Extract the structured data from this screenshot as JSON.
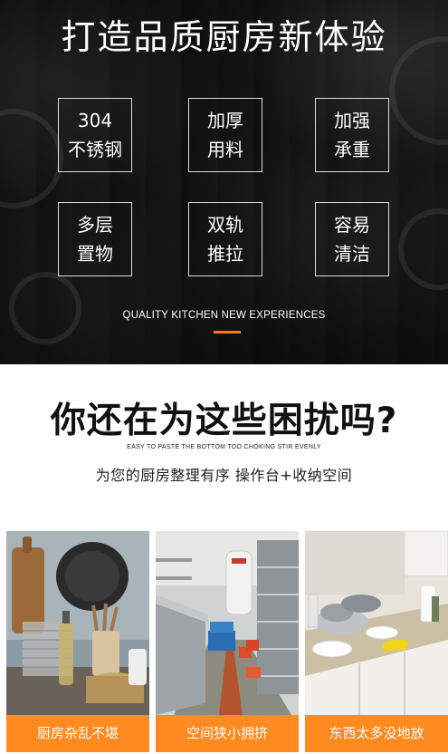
{
  "hero": {
    "title": "打造品质厨房新体验",
    "features": [
      {
        "line1": "304",
        "line2": "不锈钢"
      },
      {
        "line1": "加厚",
        "line2": "用料"
      },
      {
        "line1": "加强",
        "line2": "承重"
      },
      {
        "line1": "多层",
        "line2": "置物"
      },
      {
        "line1": "双轨",
        "line2": "推拉"
      },
      {
        "line1": "容易",
        "line2": "清洁"
      }
    ],
    "subtitle": "QUALITY KITCHEN NEW EXPERIENCES",
    "accent_color": "#ff7a00"
  },
  "question": {
    "title": "你还在为这些困扰吗?",
    "english": "EASY TO PASTE THE BOTTOM TOO CHOKING STIR EVENLY",
    "chinese": "为您的厨房整理有序 操作台+收纳空间"
  },
  "problems": [
    {
      "caption": "厨房杂乱不堪",
      "photo": "cluttered-counter-photo"
    },
    {
      "caption": "空间狭小拥挤",
      "photo": "narrow-kitchen-photo"
    },
    {
      "caption": "东西太多没地放",
      "photo": "messy-sink-photo"
    }
  ],
  "colors": {
    "caption_bg": "#ff8a1f",
    "hero_bg": "#141414"
  }
}
